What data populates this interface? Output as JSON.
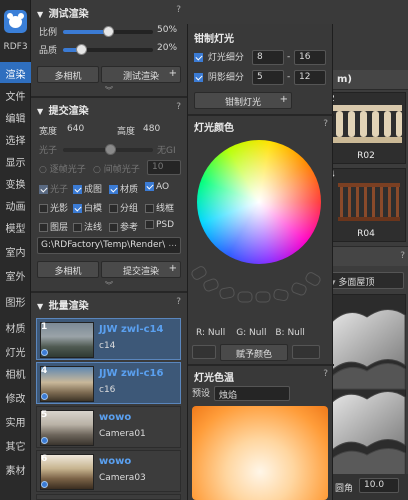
{
  "sidebar": {
    "brand": "RDF3",
    "items": [
      "渲染",
      "文件",
      "编辑",
      "选择",
      "显示",
      "变换",
      "动画",
      "模型",
      "室内",
      "室外",
      "图形",
      "材质",
      "灯光",
      "相机",
      "修改",
      "实用",
      "其它",
      "素材"
    ],
    "active_index": 0
  },
  "test_render": {
    "title": "测试渲染",
    "help": "?",
    "ratio_label": "比例",
    "ratio_value": "50%",
    "ratio_fraction": 0.5,
    "quality_label": "品质",
    "quality_value": "20%",
    "quality_fraction": 0.2,
    "multi_camera_button": "多相机",
    "test_render_button": "测试渲染",
    "plus": "+"
  },
  "submit_render": {
    "title": "提交渲染",
    "help": "?",
    "width_label": "宽度",
    "width_value": "640",
    "height_label": "高度",
    "height_value": "480",
    "photon_label": "光子",
    "photon_suffix": "无GI",
    "bake_photon_label": "逐帧光子",
    "interval_photon_label": "间帧光子",
    "interval_value": "10",
    "checkboxes_row1": [
      {
        "label": "光子",
        "checked": true,
        "disabled": true
      },
      {
        "label": "成图",
        "checked": true,
        "disabled": false
      },
      {
        "label": "材质",
        "checked": true,
        "disabled": false
      },
      {
        "label": "AO",
        "checked": true,
        "disabled": false
      }
    ],
    "checkboxes_row2": [
      {
        "label": "光影",
        "checked": false,
        "disabled": false
      },
      {
        "label": "白模",
        "checked": true,
        "disabled": false
      },
      {
        "label": "分组",
        "checked": false,
        "disabled": false
      },
      {
        "label": "线框",
        "checked": false,
        "disabled": false
      }
    ],
    "checkboxes_row3": [
      {
        "label": "图层",
        "checked": false,
        "disabled": false
      },
      {
        "label": "法线",
        "checked": false,
        "disabled": false
      },
      {
        "label": "参考",
        "checked": false,
        "disabled": false
      },
      {
        "label": "PSD",
        "checked": false,
        "disabled": false
      }
    ],
    "path_value": "G:\\RDFactory\\Temp\\Render\\",
    "browse_label": "...",
    "multi_camera_button": "多相机",
    "submit_button": "提交渲染",
    "plus": "+"
  },
  "batch_render": {
    "title": "批量渲染",
    "help": "?",
    "items": [
      {
        "index": "1",
        "title": "JJW zwl-c14",
        "subtitle": "c14",
        "selected": true
      },
      {
        "index": "4",
        "title": "JJW zwl-c16",
        "subtitle": "c16",
        "selected": true
      },
      {
        "index": "5",
        "title": "wowo",
        "subtitle": "Camera01",
        "selected": false
      },
      {
        "index": "6",
        "title": "wowo",
        "subtitle": "Camera03",
        "selected": false
      }
    ]
  },
  "light_panel": {
    "title": "钳制灯光",
    "help": "?",
    "light_subdiv_label": "灯光细分",
    "light_subdiv_min": "8",
    "light_subdiv_max": "16",
    "shadow_subdiv_label": "阴影细分",
    "shadow_subdiv_min": "5",
    "shadow_subdiv_max": "12",
    "dash": "-",
    "clamp_button": "钳制灯光",
    "plus": "+",
    "color_title": "灯光颜色",
    "rgb_r": "R: Null",
    "rgb_g": "G: Null",
    "rgb_b": "B: Null",
    "assign_color_button": "赋予颜色",
    "temp_title": "灯光色温",
    "preset_label": "预设",
    "preset_value": "烛焰"
  },
  "back_panel": {
    "title_fragment": "m)",
    "help": "?",
    "cards": [
      {
        "index": "2",
        "label": "R02"
      },
      {
        "index": "4",
        "label": "R04"
      }
    ],
    "dropdown_value": "多面屋顶",
    "corner_label": "圆角",
    "corner_value": "10.0"
  }
}
